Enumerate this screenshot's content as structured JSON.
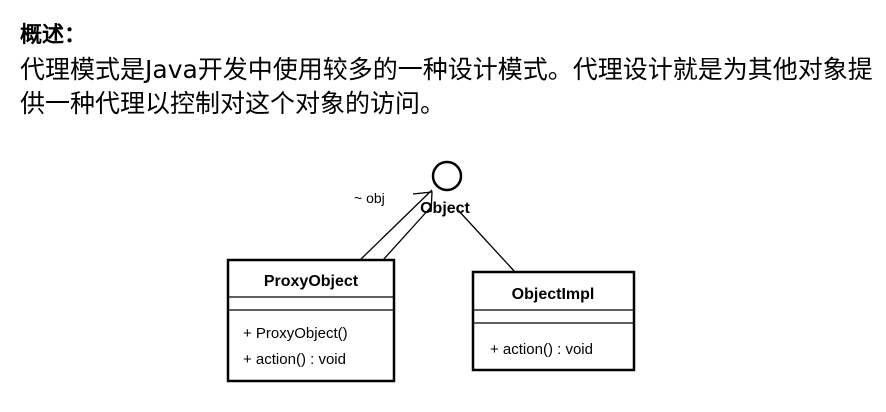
{
  "text": {
    "heading": "概述：",
    "description": "代理模式是Java开发中使用较多的一种设计模式。代理设计就是为其他对象提供一种代理以控制对这个对象的访问。"
  },
  "diagram": {
    "interface": {
      "name": "Object"
    },
    "association": {
      "label": "~ obj"
    },
    "classes": [
      {
        "name": "ProxyObject",
        "members": [
          "+ ProxyObject()",
          "+ action() : void"
        ]
      },
      {
        "name": "ObjectImpl",
        "members": [
          "+ action() : void"
        ]
      }
    ]
  }
}
